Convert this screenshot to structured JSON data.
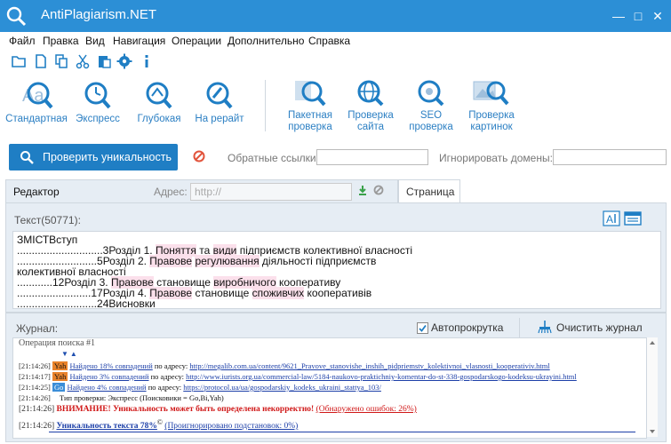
{
  "window": {
    "title": "AntiPlagiarism.NET",
    "controls": [
      "—",
      "□",
      "✕"
    ]
  },
  "menu": [
    "Файл",
    "Правка",
    "Вид",
    "Навигация",
    "Операции",
    "Дополнительно",
    "Справка"
  ],
  "toolbar_icons": [
    "open-folder-icon",
    "new-file-icon",
    "copy-icon",
    "cut-icon",
    "paste-icon",
    "settings-icon",
    "info-icon"
  ],
  "ribbon": {
    "check_modes": [
      {
        "label": "Стандартная",
        "icon": "standard-check-icon"
      },
      {
        "label": "Экспресс",
        "icon": "express-check-icon"
      },
      {
        "label": "Глубокая",
        "icon": "deep-check-icon"
      },
      {
        "label": "На рерайт",
        "icon": "rewrite-check-icon"
      }
    ],
    "tools": [
      {
        "line1": "Пакетная",
        "line2": "проверка",
        "icon": "batch-check-icon"
      },
      {
        "line1": "Проверка",
        "line2": "сайта",
        "icon": "site-check-icon"
      },
      {
        "line1": "SEO",
        "line2": "проверка",
        "icon": "seo-check-icon"
      },
      {
        "line1": "Проверка",
        "line2": "картинок",
        "icon": "image-check-icon"
      }
    ]
  },
  "search": {
    "check_button": "Проверить уникальность",
    "backlinks_label": "Обратные ссылки:",
    "backlinks_value": "",
    "ignore_domains_label": "Игнорировать домены:",
    "ignore_domains_value": ""
  },
  "editor_tab": {
    "label": "Редактор",
    "address_label": "Адрес:",
    "address_placeholder": "http://",
    "page_tab": "Страница"
  },
  "editor": {
    "text_label": "Текст(50771):",
    "lines": [
      [
        {
          "t": "ЗМІСТВступ"
        }
      ],
      [
        {
          "t": ".............................3Розділ 1. "
        },
        {
          "t": "Поняття",
          "h": true
        },
        {
          "t": " та "
        },
        {
          "t": "види",
          "h": true
        },
        {
          "t": " підприємств колективної власності"
        }
      ],
      [
        {
          "t": "...........................5Розділ 2. "
        },
        {
          "t": "Правове",
          "h": true
        },
        {
          "t": " "
        },
        {
          "t": "регулювання",
          "h": true
        },
        {
          "t": " діяльності підприємств"
        }
      ],
      [
        {
          "t": "колективної власності"
        }
      ],
      [
        {
          "t": "............12Розділ 3. "
        },
        {
          "t": "Правове",
          "h": true
        },
        {
          "t": " становище "
        },
        {
          "t": "виробничого",
          "h": true
        },
        {
          "t": " кооперативу"
        }
      ],
      [
        {
          "t": ".........................17Розділ 4. "
        },
        {
          "t": "Правове",
          "h": true
        },
        {
          "t": " становище "
        },
        {
          "t": "споживчих",
          "h": true
        },
        {
          "t": " кооперативів"
        }
      ],
      [
        {
          "t": "...........................24Висновки"
        }
      ]
    ]
  },
  "journal": {
    "label": "Журнал:",
    "autoscroll_label": "Автопрокрутка",
    "autoscroll_checked": true,
    "clear_label": "Очистить журнал",
    "entries": {
      "op": "Операция поиска #1",
      "arrows": "▼  ▲",
      "r1": {
        "ts": "[21:14:26]",
        "engine": "Yah",
        "link": "Найдено 18% совпадений",
        "mid": " по адресу: ",
        "url": "http://megalib.com.ua/content/9621_Pravove_stanovishe_inshih_pidpriemstv_kolektivnoi_vlasnosti_kooperativiv.html"
      },
      "r2": {
        "ts": "[21:14:17]",
        "engine": "Yah",
        "link": "Найдено 3% совпадений",
        "mid": " по адресу: ",
        "url": "http://www.iurists.org.ua/commercial-law/5184-naukovo-praktichniy-komentar-do-st-338-gospodarskogo-kodeksu-ukrayini.html"
      },
      "r3": {
        "ts": "[21:14:25]",
        "engine": "Go",
        "link": "Найдено 4% совпадений",
        "mid": " по адресу: ",
        "url": "https://protocol.ua/ua/gospodarskiy_kodeks_ukraini_stattya_103/"
      },
      "r4": {
        "ts": "[21:14:26]",
        "text": "Тип проверки: Экспресс (Поисковики = Go,Bi,Yah)"
      },
      "r5": {
        "ts": "[21:14:26]",
        "warn": "ВНИМАНИЕ! Уникальность может быть определена некорректно!",
        "extra": "(Обнаружено ошибок: 26%)"
      },
      "r6": {
        "ts": "[21:14:26]",
        "uniq": "Уникальность текста 78%",
        "sup": "©",
        "ignored": "(Проигнорировано подстановок: 0%)"
      }
    }
  },
  "colors": {
    "titlebar": "#2c8fd6",
    "accent": "#1f7ec4",
    "highlight": "#fbe0eb",
    "yah": "#e8822a",
    "go": "#3b8ed8",
    "warn": "#d01818"
  }
}
